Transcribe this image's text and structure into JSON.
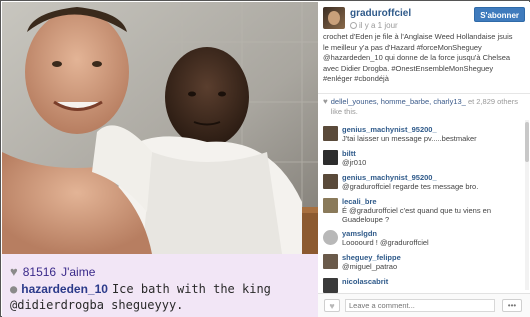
{
  "photo": {
    "likes_count": "81516",
    "likes_label": "J'aime",
    "caption_user": "hazardeden_10",
    "caption_line1": "Ice bath with the king",
    "caption_line2": "@didierdrogba sheguеyyy."
  },
  "post": {
    "username": "graduroffciel",
    "time_ago": "il y a 1 jour",
    "follow_label": "S'abonner",
    "caption": "crochet d'Eden je file à l'Anglaise Weed Hollandaise jsuis le meilleur y'a pas d'Hazard #forceMonSheguey @hazardeden_10 qui donne de la force jusqu'à Chelsea avec Didier Drogba. #OnestEnsembleMonSheguey #enléger #cbondéjà",
    "likers": "dellel_younes, homme_barbe, charly13_",
    "likers_more": "et 2,829 others like this."
  },
  "comments": [
    {
      "user": "genius_machynist_95200_",
      "text": "J'tai laisser un message pv.....bestmaker",
      "avatar_color": "#5a4a3a"
    },
    {
      "user": "biltt",
      "text": "@jr010",
      "avatar_color": "#2d2d2d"
    },
    {
      "user": "genius_machynist_95200_",
      "text": "@graduroffciel regarde tes message bro.",
      "avatar_color": "#5a4a3a"
    },
    {
      "user": "lecali_bre",
      "text": "É @graduroffciel c'est quand que tu viens en Guadeloupe ?",
      "avatar_color": "#8a7a5a"
    },
    {
      "user": "yamslgdn",
      "text": "Loooourd ! @graduroffciel",
      "avatar_color": "#b8b8b8"
    },
    {
      "user": "sheguey_felippe",
      "text": "@miguel_patrao",
      "avatar_color": "#6a5a4a"
    },
    {
      "user": "nicolascabrit",
      "text": "",
      "avatar_color": "#3a3a3a"
    }
  ],
  "footer": {
    "comment_placeholder": "Leave a comment...",
    "more_label": "•••"
  },
  "colors": {
    "link_blue": "#2f5a8a",
    "follow_button": "#3f7bbd",
    "caption_bg": "#f2e6f6"
  }
}
